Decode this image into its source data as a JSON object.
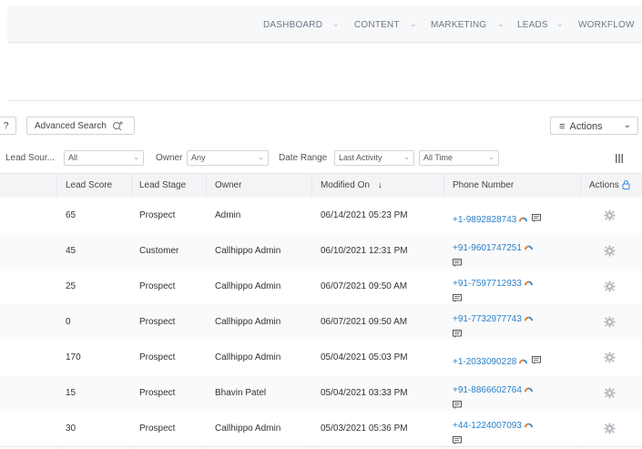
{
  "nav": {
    "items": [
      "DASHBOARD",
      "CONTENT",
      "MARKETING",
      "LEADS",
      "WORKFLOW"
    ]
  },
  "toolbar": {
    "left_partial": "?",
    "advanced_search": "Advanced Search",
    "actions": "Actions"
  },
  "filters": {
    "lead_source_label": "Lead Sour...",
    "lead_source_value": "All",
    "owner_label": "Owner",
    "owner_value": "Any",
    "date_range_label": "Date Range",
    "date_field_value": "Last Activity",
    "date_period_value": "All Time"
  },
  "table": {
    "headers": {
      "lead_score": "Lead Score",
      "lead_stage": "Lead Stage",
      "owner": "Owner",
      "modified_on": "Modified On",
      "phone": "Phone Number",
      "actions": "Actions"
    },
    "rows": [
      {
        "score": "65",
        "stage": "Prospect",
        "owner": "Admin",
        "modified": "06/14/2021 05:23 PM",
        "phone": "+1-9892828743"
      },
      {
        "score": "45",
        "stage": "Customer",
        "owner": "Callhippo Admin",
        "modified": "06/10/2021 12:31 PM",
        "phone": "+91-9601747251"
      },
      {
        "score": "25",
        "stage": "Prospect",
        "owner": "Callhippo Admin",
        "modified": "06/07/2021 09:50 AM",
        "phone": "+91-7597712933"
      },
      {
        "score": "0",
        "stage": "Prospect",
        "owner": "Callhippo Admin",
        "modified": "06/07/2021 09:50 AM",
        "phone": "+91-7732977743"
      },
      {
        "score": "170",
        "stage": "Prospect",
        "owner": "Callhippo Admin",
        "modified": "05/04/2021 05:03 PM",
        "phone": "+1-2033090228"
      },
      {
        "score": "15",
        "stage": "Prospect",
        "owner": "Bhavin Patel",
        "modified": "05/04/2021 03:33 PM",
        "phone": "+91-8866602764"
      },
      {
        "score": "30",
        "stage": "Prospect",
        "owner": "Callhippo Admin",
        "modified": "05/03/2021 05:36 PM",
        "phone": "+44-1224007093"
      }
    ]
  },
  "colors": {
    "link": "#2a7fc7",
    "nav_text": "#6f7785",
    "header_bg": "#f3f4f6",
    "lock_icon": "#3b8de0",
    "hippo_orange": "#f07f26",
    "hippo_blue": "#2e8bdb"
  },
  "icons": [
    "chevron-down-icon",
    "search-plus-icon",
    "menu-icon",
    "columns-icon",
    "lock-icon",
    "callhippo-icon",
    "sms-icon",
    "gear-icon",
    "sort-down-icon"
  ]
}
